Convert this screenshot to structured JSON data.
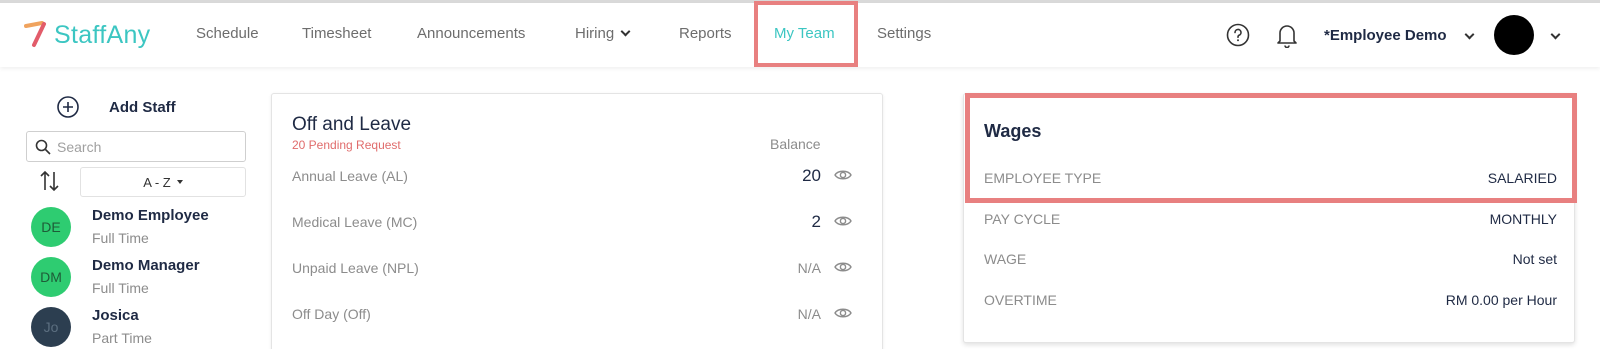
{
  "brand": {
    "name": "StaffAny",
    "accent": "#3cc6c2",
    "highlight": "#e88080"
  },
  "nav": {
    "items": [
      {
        "label": "Schedule"
      },
      {
        "label": "Timesheet"
      },
      {
        "label": "Announcements"
      },
      {
        "label": "Hiring"
      },
      {
        "label": "Reports"
      },
      {
        "label": "My Team"
      },
      {
        "label": "Settings"
      }
    ],
    "active": "My Team",
    "user_name": "*Employee Demo"
  },
  "sidebar": {
    "add_staff_label": "Add Staff",
    "search_placeholder": "Search",
    "sort_label": "A - Z",
    "staff": [
      {
        "initials": "DE",
        "name": "Demo Employee",
        "type": "Full Time",
        "color": "#2ecc71"
      },
      {
        "initials": "DM",
        "name": "Demo Manager",
        "type": "Full Time",
        "color": "#2ecc71"
      },
      {
        "initials": "Jo",
        "name": "Josica",
        "type": "Part Time",
        "color": "#2c3e50"
      }
    ]
  },
  "leave": {
    "title": "Off and Leave",
    "pending": "20 Pending Request",
    "balance_header": "Balance",
    "rows": [
      {
        "label": "Annual Leave (AL)",
        "value": "20"
      },
      {
        "label": "Medical Leave (MC)",
        "value": "2"
      },
      {
        "label": "Unpaid Leave (NPL)",
        "value": "N/A"
      },
      {
        "label": "Off Day (Off)",
        "value": "N/A"
      }
    ]
  },
  "wages": {
    "title": "Wages",
    "rows": [
      {
        "label": "EMPLOYEE TYPE",
        "value": "SALARIED"
      },
      {
        "label": "PAY CYCLE",
        "value": "MONTHLY"
      },
      {
        "label": "WAGE",
        "value": "Not set"
      },
      {
        "label": "OVERTIME",
        "value": "RM 0.00 per Hour"
      }
    ]
  }
}
